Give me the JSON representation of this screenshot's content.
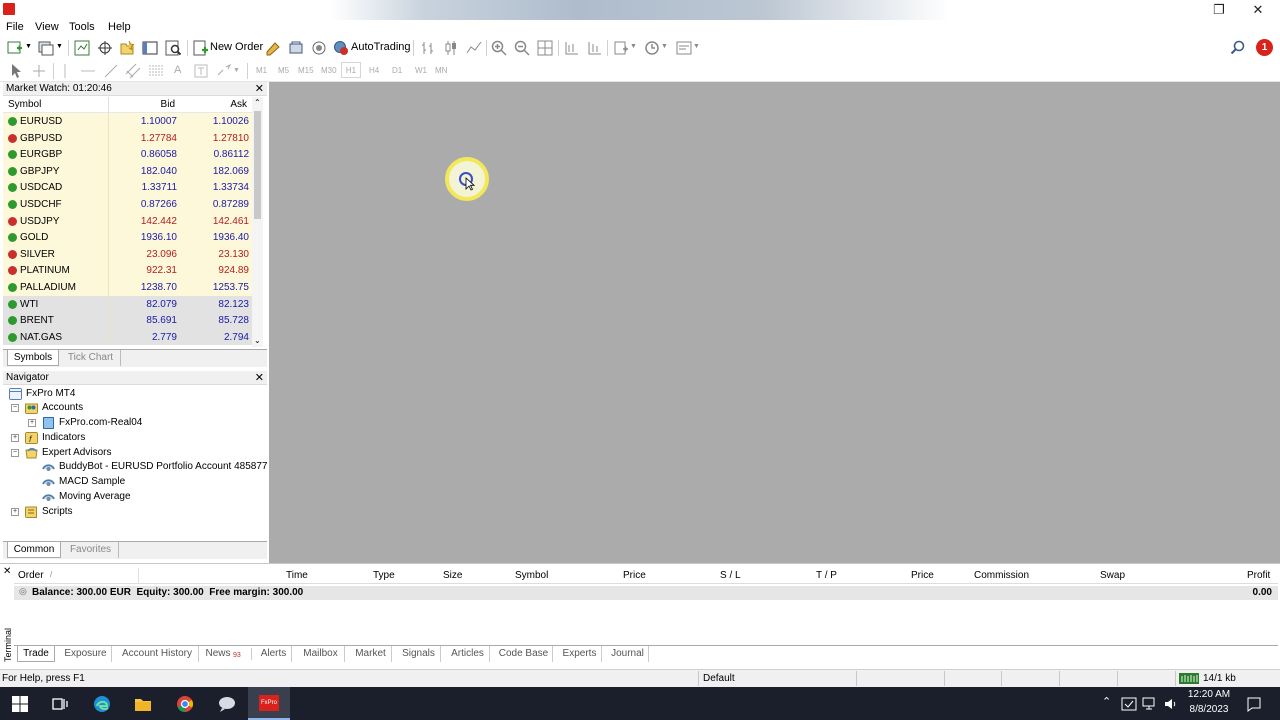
{
  "menu": [
    "File",
    "View",
    "Tools",
    "Help"
  ],
  "toolbar": {
    "new_order": "New Order",
    "autotrading": "AutoTrading",
    "timeframes": [
      "M1",
      "M5",
      "M15",
      "M30",
      "H1",
      "H4",
      "D1",
      "W1",
      "MN"
    ],
    "notification_count": "1"
  },
  "market_watch": {
    "title": "Market Watch: 01:20:46",
    "columns": {
      "symbol": "Symbol",
      "bid": "Bid",
      "ask": "Ask"
    },
    "rows": [
      {
        "symbol": "EURUSD",
        "bid": "1.10007",
        "ask": "1.10026",
        "dir": "up",
        "color": "#1a1aa8"
      },
      {
        "symbol": "GBPUSD",
        "bid": "1.27784",
        "ask": "1.27810",
        "dir": "down",
        "color": "#b01e1e"
      },
      {
        "symbol": "EURGBP",
        "bid": "0.86058",
        "ask": "0.86112",
        "dir": "up",
        "color": "#1a1aa8"
      },
      {
        "symbol": "GBPJPY",
        "bid": "182.040",
        "ask": "182.069",
        "dir": "up",
        "color": "#1a1aa8"
      },
      {
        "symbol": "USDCAD",
        "bid": "1.33711",
        "ask": "1.33734",
        "dir": "up",
        "color": "#1a1aa8"
      },
      {
        "symbol": "USDCHF",
        "bid": "0.87266",
        "ask": "0.87289",
        "dir": "up",
        "color": "#1a1aa8"
      },
      {
        "symbol": "USDJPY",
        "bid": "142.442",
        "ask": "142.461",
        "dir": "down",
        "color": "#b01e1e"
      },
      {
        "symbol": "GOLD",
        "bid": "1936.10",
        "ask": "1936.40",
        "dir": "up",
        "color": "#1a1aa8"
      },
      {
        "symbol": "SILVER",
        "bid": "23.096",
        "ask": "23.130",
        "dir": "down",
        "color": "#b01e1e"
      },
      {
        "symbol": "PLATINUM",
        "bid": "922.31",
        "ask": "924.89",
        "dir": "down",
        "color": "#b01e1e"
      },
      {
        "symbol": "PALLADIUM",
        "bid": "1238.70",
        "ask": "1253.75",
        "dir": "up",
        "color": "#1a1aa8"
      },
      {
        "symbol": "WTI",
        "bid": "82.079",
        "ask": "82.123",
        "dir": "up",
        "color": "#1a1aa8"
      },
      {
        "symbol": "BRENT",
        "bid": "85.691",
        "ask": "85.728",
        "dir": "up",
        "color": "#1a1aa8"
      },
      {
        "symbol": "NAT.GAS",
        "bid": "2.779",
        "ask": "2.794",
        "dir": "up",
        "color": "#1a1aa8"
      }
    ],
    "tabs": [
      "Symbols",
      "Tick Chart"
    ]
  },
  "navigator": {
    "title": "Navigator",
    "root": "FxPro MT4",
    "accounts": "Accounts",
    "account": "FxPro.com-Real04",
    "indicators": "Indicators",
    "expert_advisors": "Expert Advisors",
    "eas": [
      "BuddyBot - EURUSD Portfolio Account 485877",
      "MACD Sample",
      "Moving Average"
    ],
    "scripts": "Scripts",
    "tabs": [
      "Common",
      "Favorites"
    ]
  },
  "terminal": {
    "label": "Terminal",
    "columns": [
      "Order",
      "Time",
      "Type",
      "Size",
      "Symbol",
      "Price",
      "S / L",
      "T / P",
      "Price",
      "Commission",
      "Swap",
      "Profit"
    ],
    "order_sort_marker": "/",
    "balance_text": "Balance: 300.00 EUR  Equity: 300.00  Free margin: 300.00",
    "balance_profit": "0.00",
    "tabs": [
      "Trade",
      "Exposure",
      "Account History",
      "News",
      "Alerts",
      "Mailbox",
      "Market",
      "Signals",
      "Articles",
      "Code Base",
      "Experts",
      "Journal"
    ],
    "news_count": "93"
  },
  "status": {
    "help": "For Help, press F1",
    "profile": "Default",
    "traffic": "14/1 kb"
  },
  "taskbar": {
    "time": "12:20 AM",
    "date": "8/8/2023"
  }
}
